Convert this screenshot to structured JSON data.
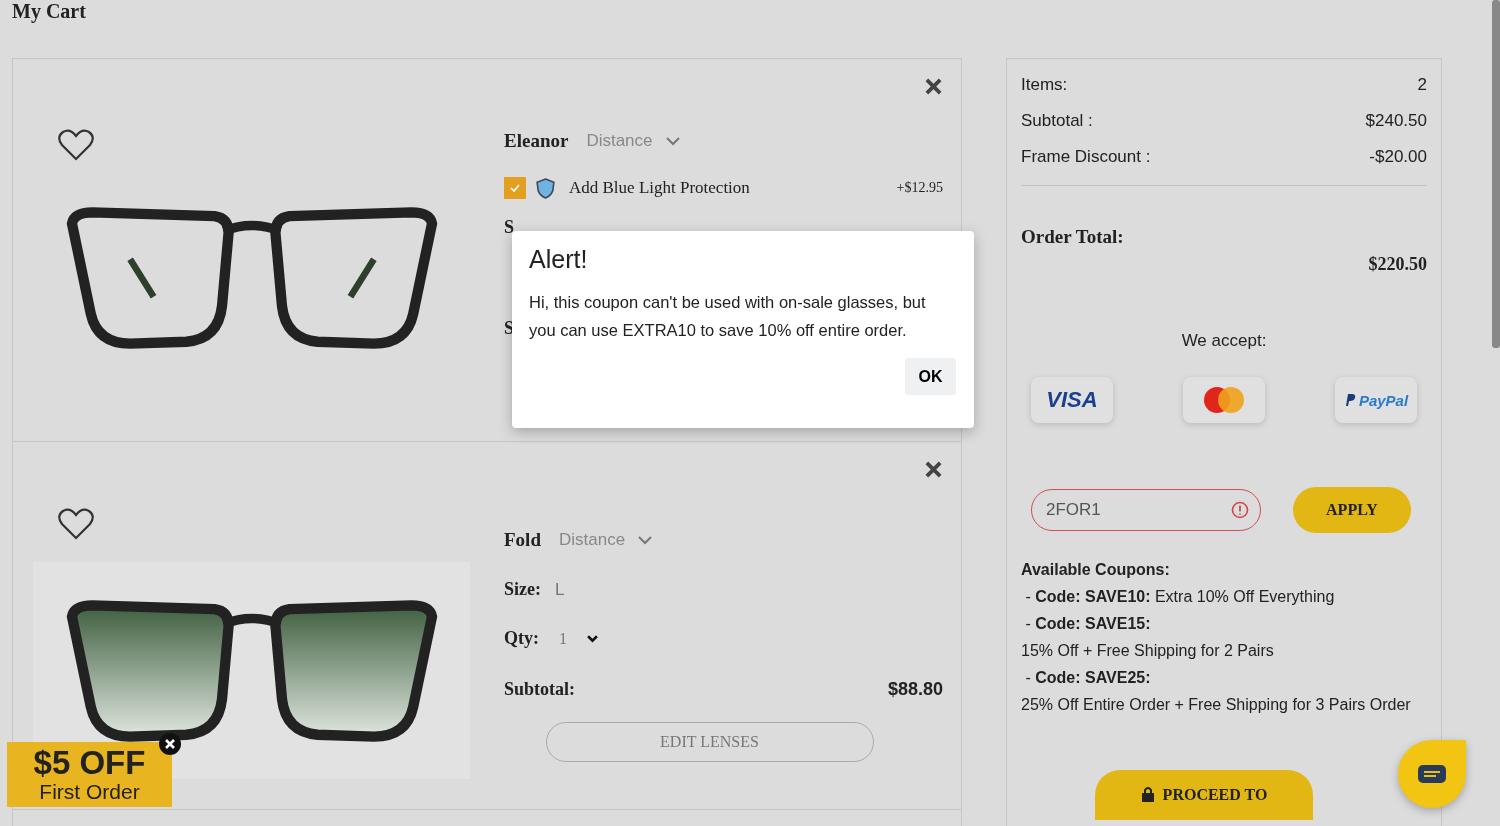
{
  "page_title": "My Cart",
  "items": [
    {
      "kind": "clear",
      "name": "Eleanor",
      "lens": "Distance",
      "addon": {
        "label": "Add Blue Light Protection",
        "price": "+$12.95",
        "checked": true
      },
      "covered_labels": [
        "S",
        "S"
      ]
    },
    {
      "kind": "tinted",
      "name": "Fold",
      "lens": "Distance",
      "size_label": "Size:",
      "size": "L",
      "qty_label": "Qty:",
      "qty": "1",
      "subtotal_label": "Subtotal:",
      "subtotal": "$88.80",
      "button": "EDIT LENSES"
    }
  ],
  "summary": {
    "rows": [
      {
        "label": "Items:",
        "value": "2"
      },
      {
        "label": "Subtotal :",
        "value": "$240.50"
      },
      {
        "label": "Frame Discount :",
        "value": "-$20.00"
      }
    ],
    "order_total_label": "Order Total:",
    "order_total": "$220.50",
    "accept_label": "We accept:",
    "payment_methods": [
      {
        "kind": "visa",
        "label": "VISA"
      },
      {
        "kind": "mastercard"
      },
      {
        "kind": "paypal",
        "label": "PayPal"
      }
    ],
    "coupon": {
      "value": "2FOR1",
      "error": true
    },
    "apply": "APPLY",
    "coupons_title": "Available Coupons:",
    "coupon_lines": [
      " - **Code: SAVE10:** Extra 10% Off Everything",
      " - **Code: SAVE15:**",
      "15% Off + Free Shipping for 2 Pairs",
      " - **Code: SAVE25:**",
      "25% Off Entire Order + Free Shipping for 3 Pairs Order"
    ],
    "proceed": "PROCEED TO"
  },
  "alert": {
    "title": "Alert!",
    "message": "Hi, this coupon can't be used with on-sale glasses, but you can use EXTRA10 to save 10% off entire order.",
    "button": "OK"
  },
  "promo": {
    "amount": "$5 OFF",
    "caption": "First Order"
  }
}
